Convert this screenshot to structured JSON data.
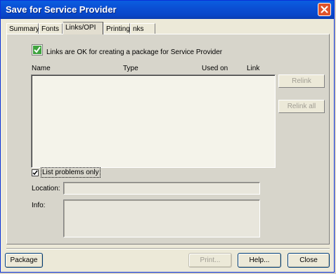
{
  "window": {
    "title": "Save for Service Provider"
  },
  "tabs": [
    "Summary",
    "Fonts",
    "Links/OPI",
    "Printing",
    "nks"
  ],
  "active_tab": "Links/OPI",
  "links_ok": {
    "label": "Links are OK for creating a package for Service Provider",
    "checked": true
  },
  "columns": {
    "name": "Name",
    "type": "Type",
    "used_on": "Used on",
    "link": "Link"
  },
  "side_buttons": {
    "relink": "Relink",
    "relink_all": "Relink all"
  },
  "list_problems": {
    "label": "List problems only",
    "checked": true
  },
  "fields": {
    "location_label": "Location:",
    "info_label": "Info:"
  },
  "footer": {
    "package": "Package",
    "print": "Print...",
    "help": "Help...",
    "close": "Close"
  },
  "colors": {
    "titlebar": "#0a4fd4",
    "check_green": "#3fa33f",
    "close_red": "#e0532b"
  }
}
